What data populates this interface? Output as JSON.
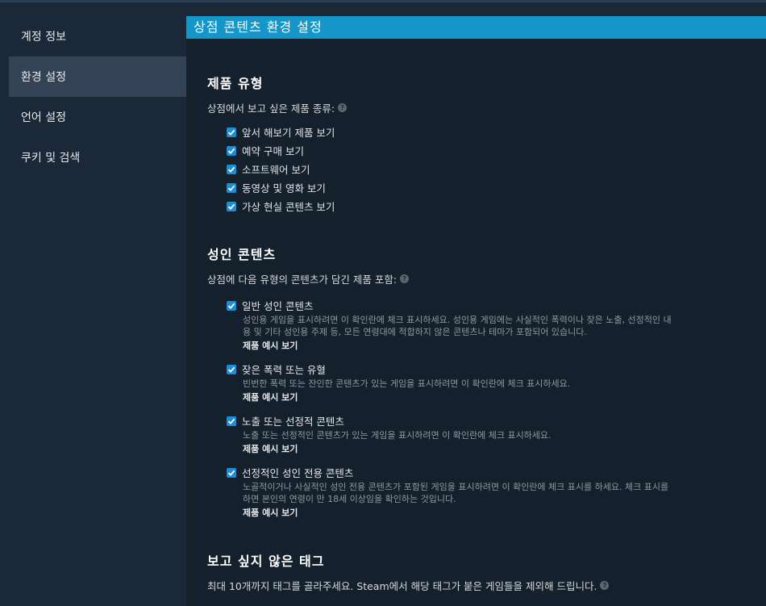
{
  "sidebar": {
    "items": [
      {
        "label": "계정 정보"
      },
      {
        "label": "환경 설정"
      },
      {
        "label": "언어 설정"
      },
      {
        "label": "쿠키 및 검색"
      }
    ]
  },
  "header": {
    "title": "상점 콘텐츠 환경 설정"
  },
  "product_types": {
    "title": "제품 유형",
    "desc": "상점에서 보고 싶은 제품 종류:",
    "help": "?",
    "options": [
      {
        "label": "앞서 해보기 제품 보기",
        "checked": true
      },
      {
        "label": "예약 구매 보기",
        "checked": true
      },
      {
        "label": "소프트웨어 보기",
        "checked": true
      },
      {
        "label": "동영상 및 영화 보기",
        "checked": true
      },
      {
        "label": "가상 현실 콘텐츠 보기",
        "checked": true
      }
    ]
  },
  "adult": {
    "title": "성인 콘텐츠",
    "desc": "상점에 다음 유형의 콘텐츠가 담긴 제품 포함:",
    "help": "?",
    "options": [
      {
        "label": "일반 성인 콘텐츠",
        "checked": true,
        "desc1": "성인용 게임을 표시하려면 이 확인란에 체크 표시하세요. 성인용 게임에는 사실적인 폭력이나 잦은 노출, 선정적인 내",
        "desc2": "용 및 기타 성인용 주제 등, 모든 연령대에 적합하지 않은 콘텐츠나 테마가 포함되어 있습니다.",
        "link": "제품 예시 보기"
      },
      {
        "label": "잦은 폭력 또는 유혈",
        "checked": true,
        "desc1": "빈번한 폭력 또는 잔인한 콘텐츠가 있는 게임을 표시하려면 이 확인란에 체크 표시하세요.",
        "desc2": "",
        "link": "제품 예시 보기"
      },
      {
        "label": "노출 또는 선정적 콘텐츠",
        "checked": true,
        "desc1": "노출 또는 선정적인 콘텐츠가 있는 게임을 표시하려면 이 확인란에 체크 표시하세요.",
        "desc2": "",
        "link": "제품 예시 보기"
      },
      {
        "label": "선정적인 성인 전용 콘텐츠",
        "checked": true,
        "desc1": "노골적이거나 사실적인 성인 전용 콘텐츠가 포함된 게임을 표시하려면 이 확인란에 체크 표시를 하세요. 체크 표시를",
        "desc2": "하면 본인의 연령이 만 18세 이상임을 확인하는 것입니다.",
        "link": "제품 예시 보기"
      }
    ]
  },
  "tags": {
    "title": "보고 싶지 않은 태그",
    "desc": "최대 10개까지 태그를 골라주세요. Steam에서 해당 태그가 붙은 게임들을 제외해 드립니다.",
    "help": "?"
  },
  "colors": {
    "accent": "#1596c8",
    "checkbox": "#1a8fd8",
    "bg": "#1b2838",
    "panel": "#15202d"
  },
  "icons": {
    "checkbox": "check-icon",
    "help": "help-icon"
  }
}
